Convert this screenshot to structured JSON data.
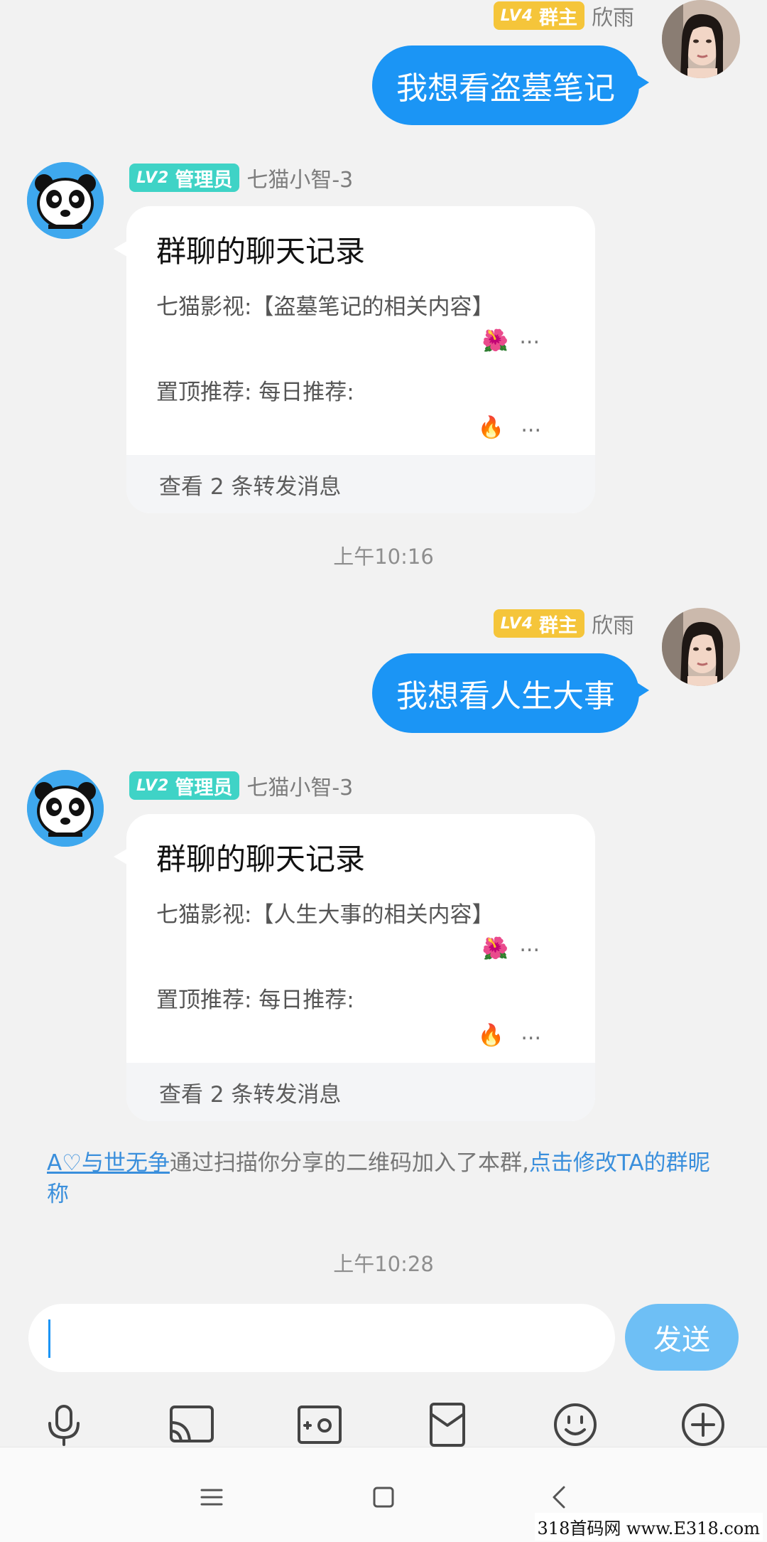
{
  "messages": [
    {
      "type": "out",
      "level": "LV4",
      "role": "群主",
      "name": "欣雨",
      "text": "我想看盗墓笔记"
    },
    {
      "type": "in",
      "level": "LV2",
      "role": "管理员",
      "name": "七猫小智-3",
      "card_title": "群聊的聊天记录",
      "line1": "七猫影视:【盗墓笔记的相关内容】",
      "line2_emoji": "🌺",
      "line2_dots": "...",
      "line3": "置顶推荐: 每日推荐:",
      "line4_emoji": "🔥",
      "line4_dots": "...",
      "footer": "查看 2 条转发消息"
    },
    {
      "type": "time",
      "text": "上午10:16"
    },
    {
      "type": "out",
      "level": "LV4",
      "role": "群主",
      "name": "欣雨",
      "text": "我想看人生大事"
    },
    {
      "type": "in",
      "level": "LV2",
      "role": "管理员",
      "name": "七猫小智-3",
      "card_title": "群聊的聊天记录",
      "line1": "七猫影视:【人生大事的相关内容】",
      "line2_emoji": "🌺",
      "line2_dots": "...",
      "line3": "置顶推荐: 每日推荐:",
      "line4_emoji": "🔥",
      "line4_dots": "...",
      "footer": "查看 2 条转发消息"
    }
  ],
  "system_notice": {
    "user_link": "A♡与世无争",
    "text": "通过扫描你分享的二维码加入了本群,",
    "action_link": "点击修改TA的群昵称"
  },
  "time2": "上午10:28",
  "input": {
    "value": "",
    "send_label": "发送"
  },
  "toolbar": {
    "icons": [
      "microphone-icon",
      "screen-cast-icon",
      "photo-icon",
      "red-packet-icon",
      "emoji-icon",
      "plus-icon"
    ]
  },
  "watermark": "318首码网 www.E318.com",
  "colors": {
    "outgoing_bubble": "#1b95f5",
    "send_button": "#6ebff5",
    "owner_badge": "#f5c53a",
    "admin_badge": "#3fd3c6",
    "link": "#3a8fdc"
  }
}
